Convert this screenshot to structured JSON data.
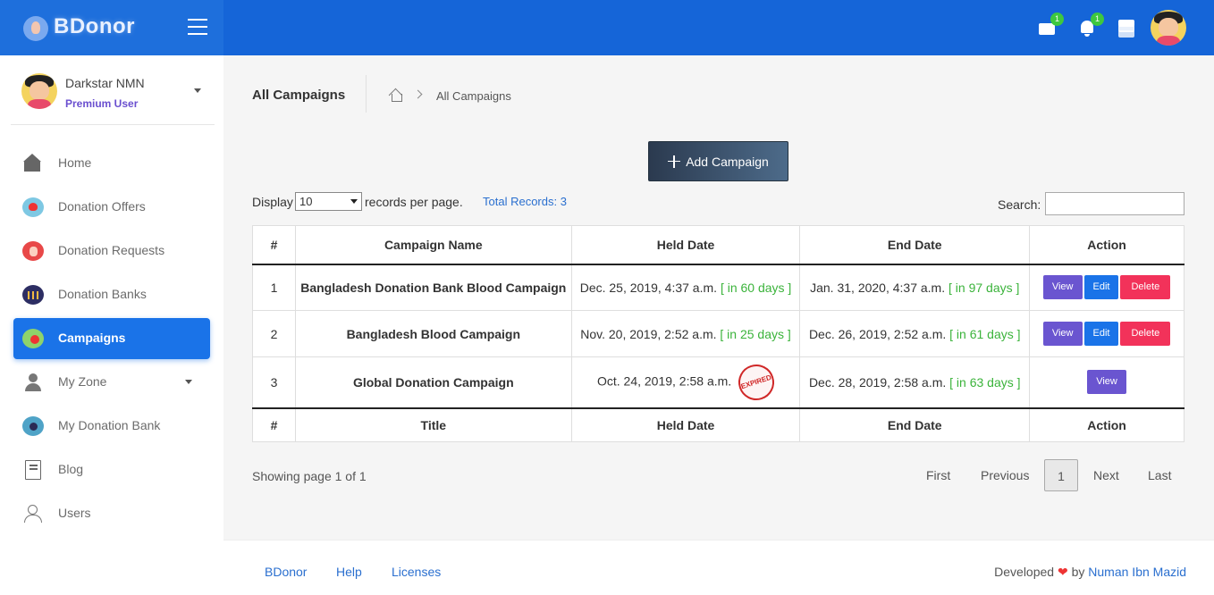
{
  "brand": {
    "name": "BDonor"
  },
  "topbar": {
    "mail_count": "1",
    "notification_count": "1"
  },
  "user": {
    "name": "Darkstar NMN",
    "role": "Premium User"
  },
  "sidebar": {
    "items": [
      {
        "label": "Home"
      },
      {
        "label": "Donation Offers"
      },
      {
        "label": "Donation Requests"
      },
      {
        "label": "Donation Banks"
      },
      {
        "label": "Campaigns"
      },
      {
        "label": "My Zone"
      },
      {
        "label": "My Donation Bank"
      },
      {
        "label": "Blog"
      },
      {
        "label": "Users"
      }
    ],
    "active": "Campaigns"
  },
  "page": {
    "title": "All Campaigns",
    "breadcrumb_current": "All Campaigns",
    "add_button": "Add Campaign",
    "display_label": "Display",
    "page_size": "10",
    "per_page_label": "records per page.",
    "total_records": "Total Records: 3",
    "search_label": "Search:",
    "search_value": ""
  },
  "table": {
    "headers": [
      "#",
      "Campaign Name",
      "Held Date",
      "End Date",
      "Action"
    ],
    "footers": [
      "#",
      "Title",
      "Held Date",
      "End Date",
      "Action"
    ],
    "rows": [
      {
        "num": "1",
        "name": "Bangladesh Donation Bank Blood Campaign",
        "held": "Dec. 25, 2019, 4:37 a.m.",
        "held_days": "[ in 60 days ]",
        "end": "Jan. 31, 2020, 4:37 a.m.",
        "end_days": "[ in 97 days ]"
      },
      {
        "num": "2",
        "name": "Bangladesh Blood Campaign",
        "held": "Nov. 20, 2019, 2:52 a.m.",
        "held_days": "[ in 25 days ]",
        "end": "Dec. 26, 2019, 2:52 a.m.",
        "end_days": "[ in 61 days ]"
      },
      {
        "num": "3",
        "name": "Global Donation Campaign",
        "held": "Oct. 24, 2019, 2:58 a.m.",
        "held_stamp": "EXPIRED",
        "end": "Dec. 28, 2019, 2:58 a.m.",
        "end_days": "[ in 63 days ]"
      }
    ],
    "actions": {
      "view": "View",
      "edit": "Edit",
      "delete": "Delete"
    }
  },
  "pagination": {
    "showing": "Showing page 1 of 1",
    "first": "First",
    "previous": "Previous",
    "current": "1",
    "next": "Next",
    "last": "Last"
  },
  "footer": {
    "links": [
      "BDonor",
      "Help",
      "Licenses"
    ],
    "developed_prefix": "Developed",
    "developed_by": "by",
    "author": "Numan Ibn Mazid"
  },
  "colors": {
    "primary": "#1565d8",
    "active_nav": "#1a73e8",
    "view": "#6a55d0",
    "edit": "#1a73e8",
    "delete": "#f2325a",
    "days": "#3bb33b",
    "expired": "#d02828"
  }
}
